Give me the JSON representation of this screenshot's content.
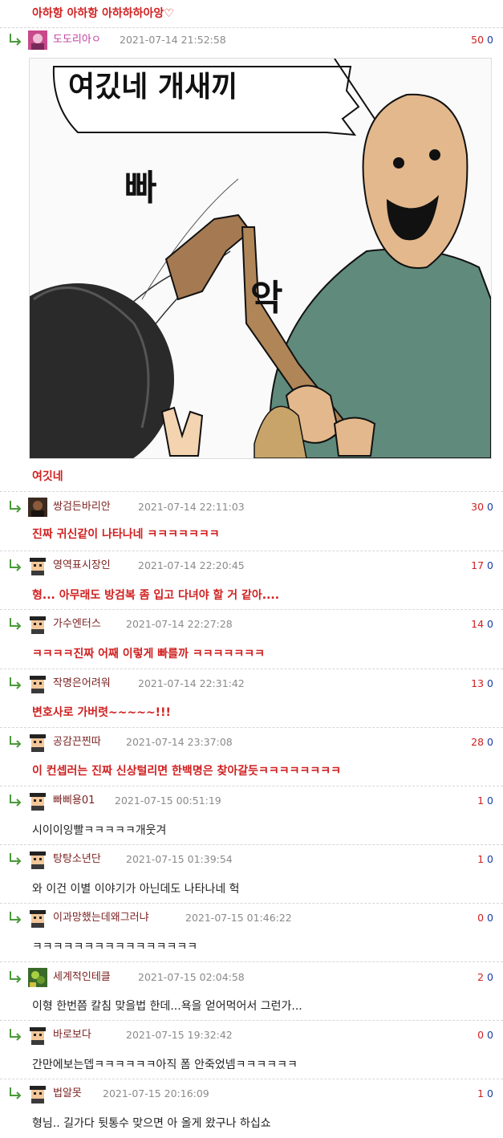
{
  "top_text": "아하항 아하항 아하하하아앙♡",
  "image": {
    "caption": "여깃네",
    "text_main": "여깄네 개새끼",
    "text_sfx1": "빠",
    "text_sfx2": "악"
  },
  "comments": [
    {
      "nick": "도도리아ㅇ",
      "time": "2021-07-14 21:52:58",
      "up": "50",
      "down": "0"
    },
    {
      "nick": "쌍검든바리안",
      "time": "2021-07-14 22:11:03",
      "up": "30",
      "down": "0",
      "text": "진짜 귀신같이 나타나네 ㅋㅋㅋㅋㅋㅋㅋ"
    },
    {
      "nick": "영역표시장인",
      "time": "2021-07-14 22:20:45",
      "up": "17",
      "down": "0",
      "text": "형... 아무래도 방검복 좀 입고 다녀야 할 거 같아...."
    },
    {
      "nick": "가수엔터스",
      "time": "2021-07-14 22:27:28",
      "up": "14",
      "down": "0",
      "text": "ㅋㅋㅋㅋ진짜 어째 이렇게 빠를까 ㅋㅋㅋㅋㅋㅋㅋ"
    },
    {
      "nick": "작명은어려워",
      "time": "2021-07-14 22:31:42",
      "up": "13",
      "down": "0",
      "text": "변호사로 가버렷~~~~~!!!"
    },
    {
      "nick": "공감끈찐따",
      "time": "2021-07-14 23:37:08",
      "up": "28",
      "down": "0",
      "text": "이 컨셉러는 진짜 신상털리면 한백명은 찾아갈듯ㅋㅋㅋㅋㅋㅋㅋㅋ"
    },
    {
      "nick": "빠삐용01",
      "time": "2021-07-15 00:51:19",
      "up": "1",
      "down": "0",
      "text": "시이이잉빨ㅋㅋㅋㅋㅋ개웃겨"
    },
    {
      "nick": "탕탕소년단",
      "time": "2021-07-15 01:39:54",
      "up": "1",
      "down": "0",
      "text": "와 이건 이별 이야기가 아닌데도 나타나네 헉"
    },
    {
      "nick": "이과망했는데왜그러냐",
      "time": "2021-07-15 01:46:22",
      "up": "0",
      "down": "0",
      "text": "ㅋㅋㅋㅋㅋㅋㅋㅋㅋㅋㅋㅋㅋㅋㅋㅋ"
    },
    {
      "nick": "세계적인테클",
      "time": "2021-07-15 02:04:58",
      "up": "2",
      "down": "0",
      "text": "이형 한번쯤 칼침 맞을법 한데...욕을 얻어먹어서 그런가..."
    },
    {
      "nick": "바로보다",
      "time": "2021-07-15 19:32:42",
      "up": "0",
      "down": "0",
      "text": "간만에보는뎁ㅋㅋㅋㅋㅋㅋ아직 폼 안죽었넴ㅋㅋㅋㅋㅋㅋ"
    },
    {
      "nick": "법알못",
      "time": "2021-07-15 20:16:09",
      "up": "1",
      "down": "0",
      "text": "형님.. 길가다 뒷통수 맞으면 아 올게 왔구나 하십쇼"
    }
  ],
  "colors": {
    "accent_red": "#d02020",
    "down_blue": "#1a3aa8",
    "reply_green": "#4a9a3a"
  }
}
